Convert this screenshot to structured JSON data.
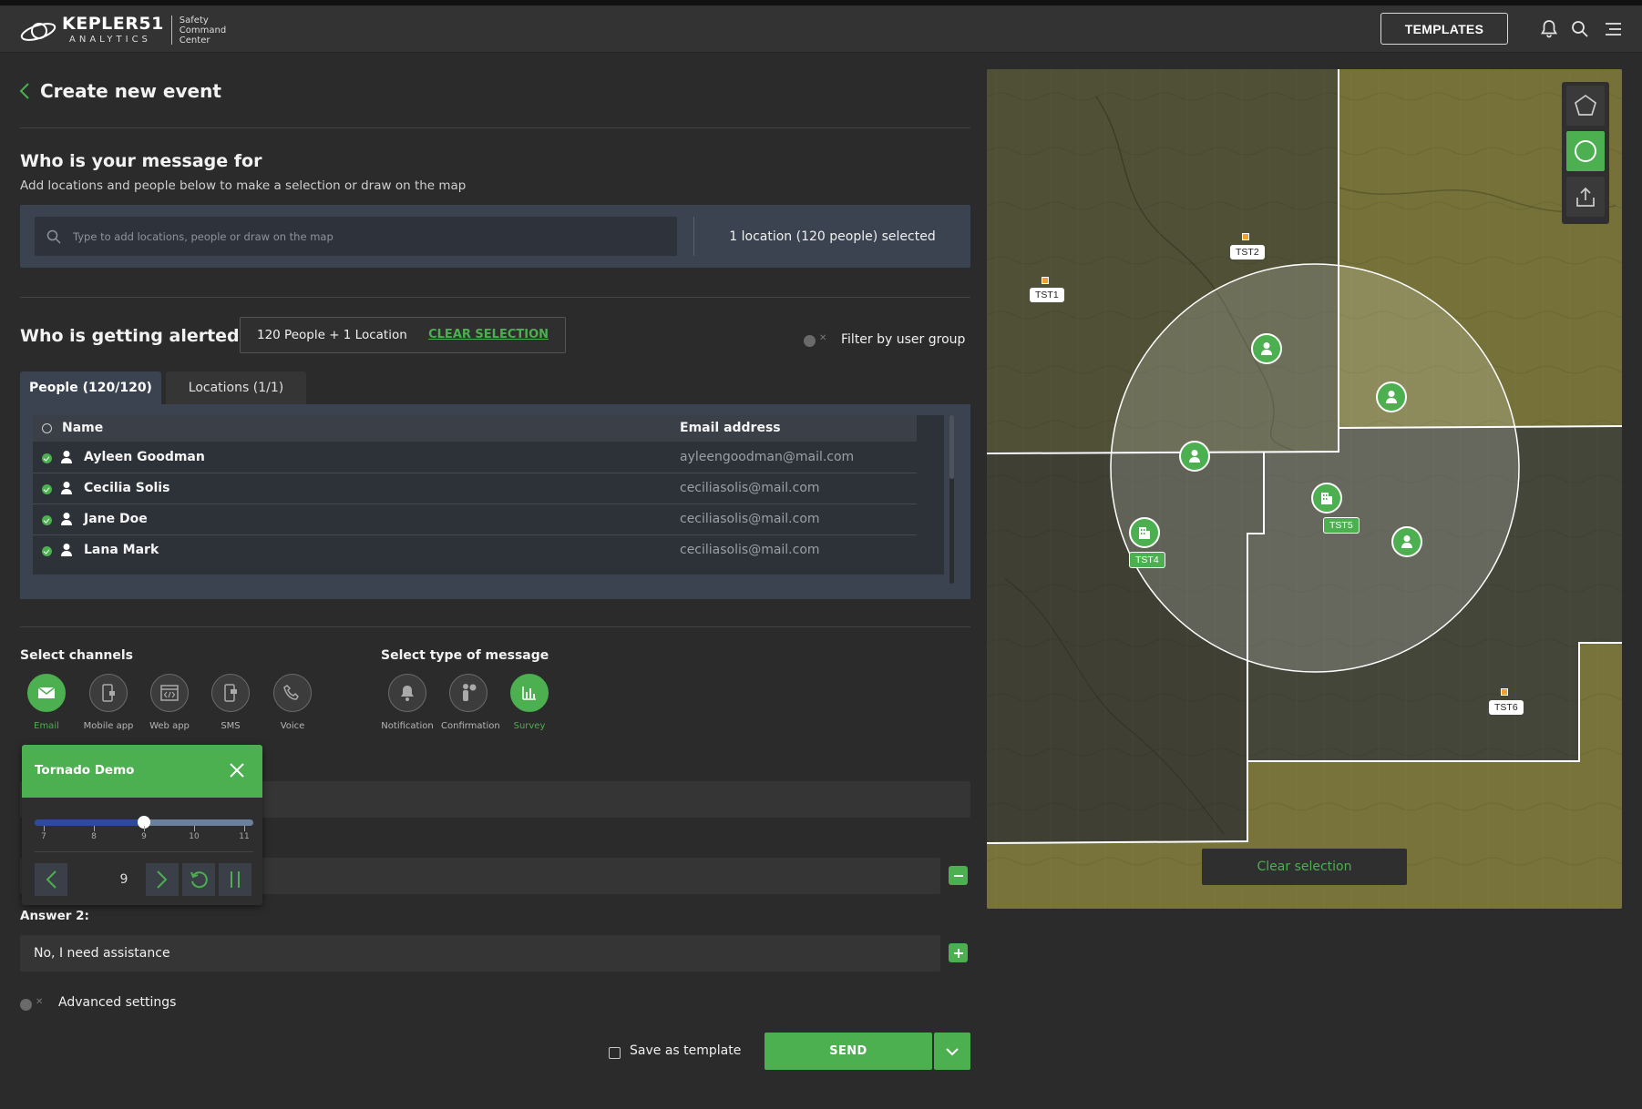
{
  "header": {
    "brand_name": "KEPLER51",
    "brand_sub": "ANALYTICS",
    "product_line1": "Safety",
    "product_line2": "Command",
    "product_line3": "Center",
    "templates_label": "TEMPLATES"
  },
  "page": {
    "title": "Create new event"
  },
  "recipients": {
    "heading": "Who is your message for",
    "subheading": "Add locations and people below to make a selection or draw on the map",
    "search_placeholder": "Type to add locations, people or draw on the map",
    "selection_summary": "1 location (120 people) selected"
  },
  "alerted": {
    "heading": "Who is getting alerted",
    "summary": "120 People + 1 Location",
    "clear_label": "CLEAR SELECTION",
    "filter_label": "Filter by user group"
  },
  "tabs": [
    {
      "label": "People (120/120)",
      "active": true
    },
    {
      "label": "Locations (1/1)",
      "active": false
    }
  ],
  "people_table": {
    "col_name": "Name",
    "col_email": "Email address",
    "rows": [
      {
        "name": "Ayleen Goodman",
        "email": "ayleengoodman@mail.com"
      },
      {
        "name": "Cecilia Solis",
        "email": "ceciliasolis@mail.com"
      },
      {
        "name": "Jane Doe",
        "email": "ceciliasolis@mail.com"
      },
      {
        "name": "Lana Mark",
        "email": "ceciliasolis@mail.com"
      }
    ]
  },
  "channels": {
    "heading": "Select channels",
    "items": [
      {
        "label": "Email",
        "icon": "envelope-icon",
        "selected": true
      },
      {
        "label": "Mobile app",
        "icon": "mobile-icon",
        "selected": false
      },
      {
        "label": "Web app",
        "icon": "code-window-icon",
        "selected": false
      },
      {
        "label": "SMS",
        "icon": "sms-icon",
        "selected": false
      },
      {
        "label": "Voice",
        "icon": "phone-icon",
        "selected": false
      }
    ]
  },
  "message_type": {
    "heading": "Select type of message",
    "items": [
      {
        "label": "Notification",
        "icon": "bell-icon",
        "selected": false
      },
      {
        "label": "Confirmation",
        "icon": "person-check-icon",
        "selected": false
      },
      {
        "label": "Survey",
        "icon": "bar-chart-icon",
        "selected": true
      }
    ]
  },
  "survey": {
    "answer2_label": "Answer 2:",
    "answer2_value": "No, I need assistance"
  },
  "advanced": {
    "label": "Advanced settings"
  },
  "footer": {
    "save_template_label": "Save as template",
    "send_label": "SEND"
  },
  "tornado_widget": {
    "title": "Tornado Demo",
    "ticks": [
      "7",
      "8",
      "9",
      "10",
      "11"
    ],
    "current_frame": "9",
    "progress_fraction": 0.5
  },
  "map": {
    "labels": [
      "TST1",
      "TST2",
      "TST4",
      "TST5",
      "TST6"
    ],
    "clear_label": "Clear selection"
  },
  "colors": {
    "accent": "#4caf50",
    "background": "#2b2b2b",
    "panel": "#3b4350",
    "map_land": "#6d6a33"
  }
}
